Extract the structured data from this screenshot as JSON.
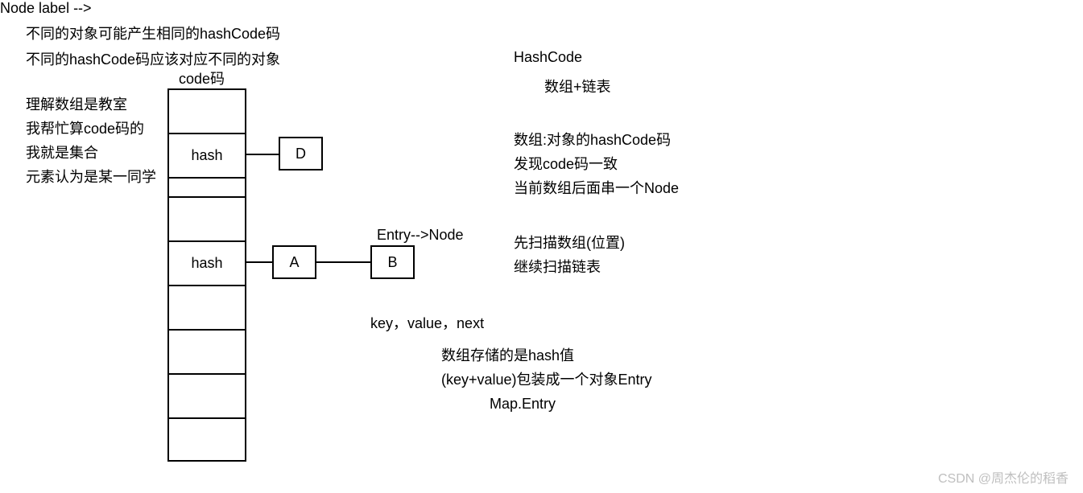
{
  "top": {
    "line1": "不同的对象可能产生相同的hashCode码",
    "line2": "不同的hashCode码应该对应不同的对象"
  },
  "left": {
    "l1": "理解数组是教室",
    "l2": "我帮忙算code码的",
    "l3": "我就是集合",
    "l4": "元素认为是某一同学"
  },
  "array_label": "code码",
  "cell_hash1": "hash",
  "cell_hash2": "hash",
  "node_d": "D",
  "node_a": "A",
  "node_b": "B",
  "entry_node": "Entry-->Node",
  "right": {
    "title": "HashCode",
    "r1": "数组+链表",
    "r2": "数组:对象的hashCode码",
    "r3": "发现code码一致",
    "r4": "当前数组后面串一个Node",
    "r5": "先扫描数组(位置)",
    "r6": "继续扫描链表"
  },
  "bottom": {
    "b1": "key，value，next",
    "b2": "数组存储的是hash值",
    "b3": "(key+value)包装成一个对象Entry",
    "b4": "Map.Entry"
  },
  "watermark": "CSDN @周杰伦的稻香"
}
